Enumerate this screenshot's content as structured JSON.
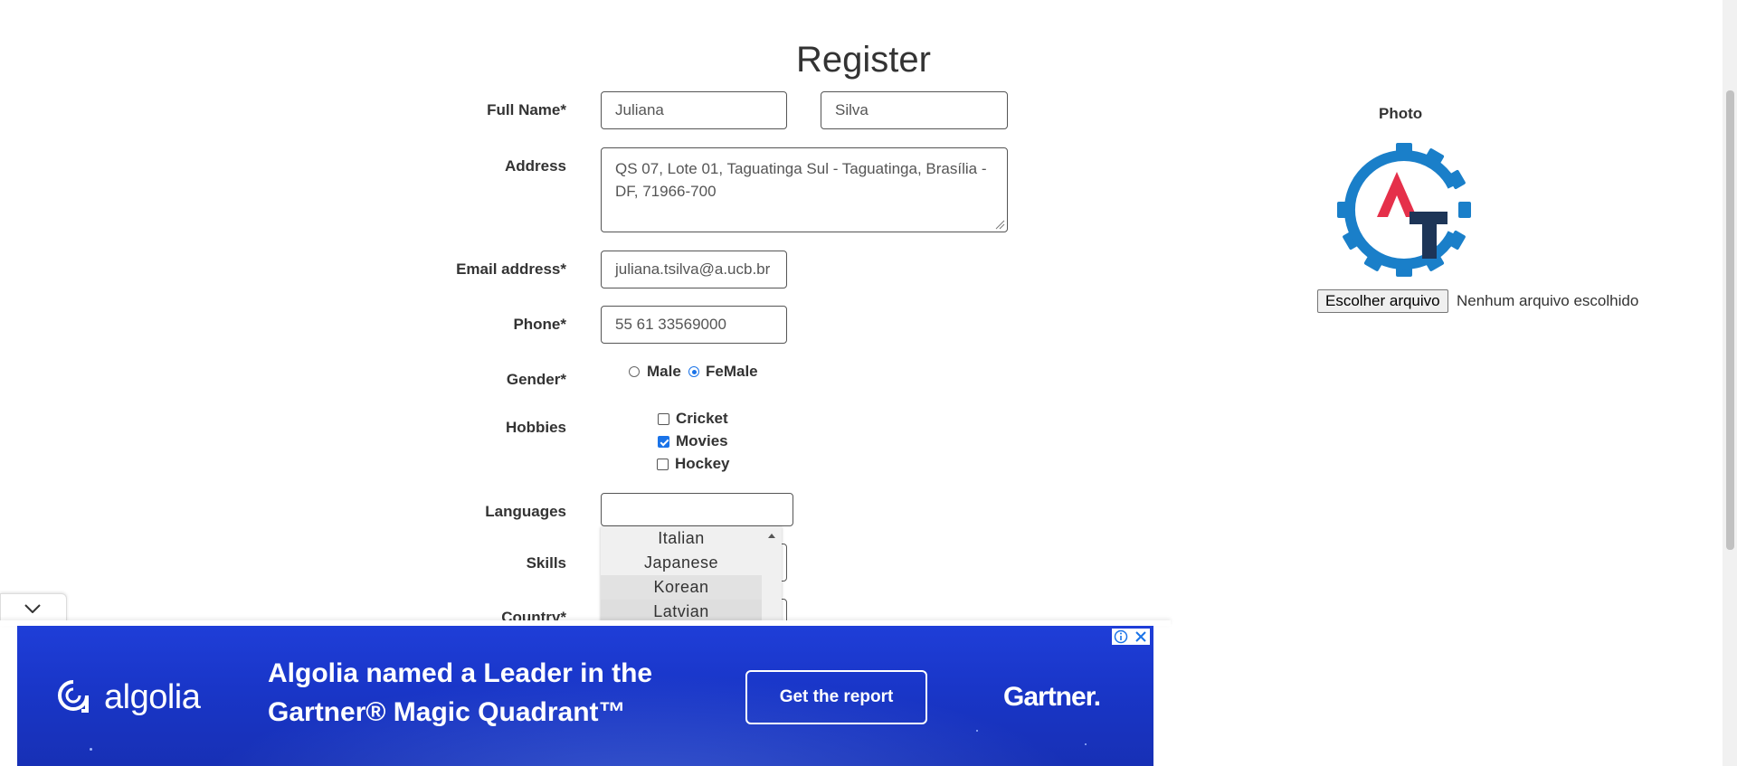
{
  "page": {
    "title": "Register"
  },
  "form": {
    "full_name": {
      "label": "Full Name*",
      "first": "Juliana",
      "last": "Silva"
    },
    "address": {
      "label": "Address",
      "value": "QS 07, Lote 01, Taguatinga Sul - Taguatinga, Brasília - DF, 71966-700"
    },
    "email": {
      "label": "Email address*",
      "value": "juliana.tsilva@a.ucb.br"
    },
    "phone": {
      "label": "Phone*",
      "value": "55 61 33569000"
    },
    "gender": {
      "label": "Gender*",
      "options": [
        "Male",
        "FeMale"
      ],
      "selected": "FeMale"
    },
    "hobbies": {
      "label": "Hobbies",
      "options": [
        {
          "label": "Cricket",
          "checked": false
        },
        {
          "label": "Movies",
          "checked": true
        },
        {
          "label": "Hockey",
          "checked": false
        }
      ]
    },
    "languages": {
      "label": "Languages",
      "dropdown": [
        "Italian",
        "Japanese",
        "Korean",
        "Latvian"
      ]
    },
    "skills": {
      "label": "Skills"
    },
    "country": {
      "label": "Country*"
    }
  },
  "photo": {
    "label": "Photo",
    "file_button": "Escolher arquivo",
    "file_status": "Nenhum arquivo escolhido",
    "logo_colors": {
      "gear": "#1a7fc9",
      "a": "#e5304a",
      "t": "#1d3557"
    }
  },
  "ad": {
    "brand": "algolia",
    "headline_line1": "Algolia named a Leader in the",
    "headline_line2": "Gartner® Magic Quadrant™",
    "cta": "Get the report",
    "partner": "Gartner.",
    "info_icon": "info-icon",
    "close_icon": "close-icon",
    "colors": {
      "bg": "#1b38cc",
      "text": "#ffffff"
    }
  }
}
